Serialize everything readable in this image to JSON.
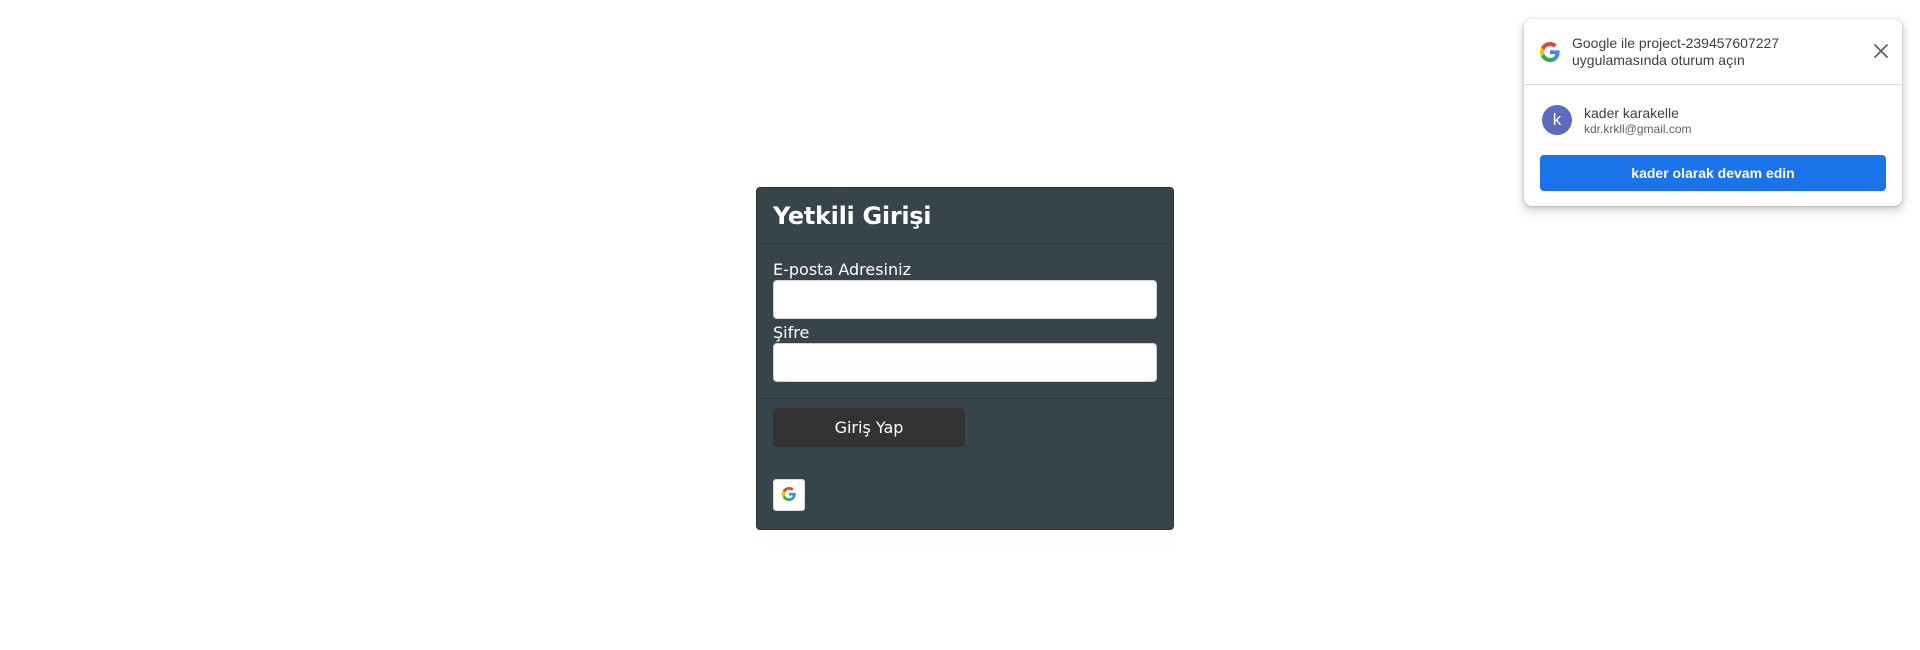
{
  "login": {
    "title": "Yetkili Girişi",
    "email_label": "E-posta Adresiniz",
    "email_value": "",
    "password_label": "Şifre",
    "password_value": "",
    "submit_label": "Giriş Yap",
    "google_button_icon": "google-g-icon"
  },
  "onetap": {
    "logo_icon": "google-g-icon",
    "title": "Google ile project-239457607227 uygulamasında oturum açın",
    "close_icon": "close-icon",
    "account": {
      "avatar_letter": "k",
      "name": "kader karakelle",
      "email": "kdr.krkll@gmail.com"
    },
    "continue_label": "kader olarak devam edin"
  },
  "colors": {
    "card_background": "#37444a",
    "button_dark": "#333333",
    "google_blue": "#1a73e8",
    "avatar_color": "#5c6bc0"
  }
}
